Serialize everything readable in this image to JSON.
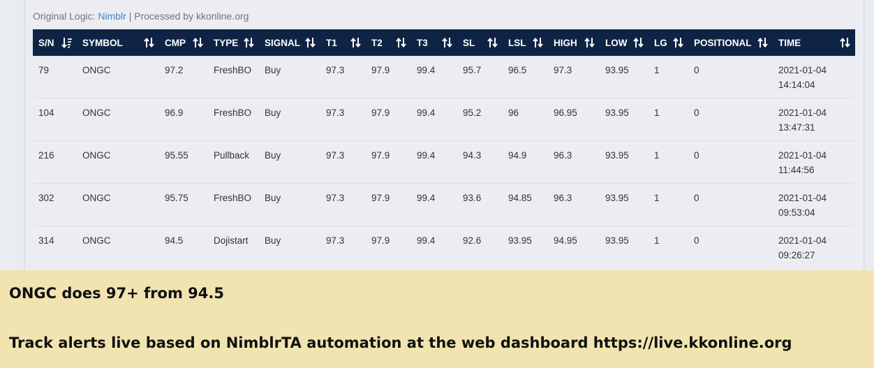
{
  "credit": {
    "prefix": "Original Logic: ",
    "link": "Nimblr",
    "suffix": " | Processed by kkonline.org"
  },
  "table": {
    "columns": [
      "S/N",
      "SYMBOL",
      "CMP",
      "TYPE",
      "SIGNAL",
      "T1",
      "T2",
      "T3",
      "SL",
      "LSL",
      "HIGH",
      "LOW",
      "LG",
      "POSITIONAL",
      "TIME"
    ],
    "rows": [
      [
        "79",
        "ONGC",
        "97.2",
        "FreshBO",
        "Buy",
        "97.3",
        "97.9",
        "99.4",
        "95.7",
        "96.5",
        "97.3",
        "93.95",
        "1",
        "0",
        "2021-01-04",
        "14:14:04"
      ],
      [
        "104",
        "ONGC",
        "96.9",
        "FreshBO",
        "Buy",
        "97.3",
        "97.9",
        "99.4",
        "95.2",
        "96",
        "96.95",
        "93.95",
        "1",
        "0",
        "2021-01-04",
        "13:47:31"
      ],
      [
        "216",
        "ONGC",
        "95.55",
        "Pullback",
        "Buy",
        "97.3",
        "97.9",
        "99.4",
        "94.3",
        "94.9",
        "96.3",
        "93.95",
        "1",
        "0",
        "2021-01-04",
        "11:44:56"
      ],
      [
        "302",
        "ONGC",
        "95.75",
        "FreshBO",
        "Buy",
        "97.3",
        "97.9",
        "99.4",
        "93.6",
        "94.85",
        "96.3",
        "93.95",
        "1",
        "0",
        "2021-01-04",
        "09:53:04"
      ],
      [
        "314",
        "ONGC",
        "94.5",
        "Dojistart",
        "Buy",
        "97.3",
        "97.9",
        "99.4",
        "92.6",
        "93.95",
        "94.95",
        "93.95",
        "1",
        "0",
        "2021-01-04",
        "09:26:27"
      ]
    ]
  },
  "banner": {
    "line1": "ONGC does 97+ from 94.5",
    "line2": "Track alerts live based on NimblrTA automation at the web dashboard https://live.kkonline.org"
  },
  "colors": {
    "header_bg": "#0f2444",
    "link": "#3a87c8",
    "banner_bg": "#f1e4b0"
  },
  "icons": {
    "first_column_sort": "sort-desc-active-icon",
    "other_columns_sort": "sort-both-icon"
  }
}
